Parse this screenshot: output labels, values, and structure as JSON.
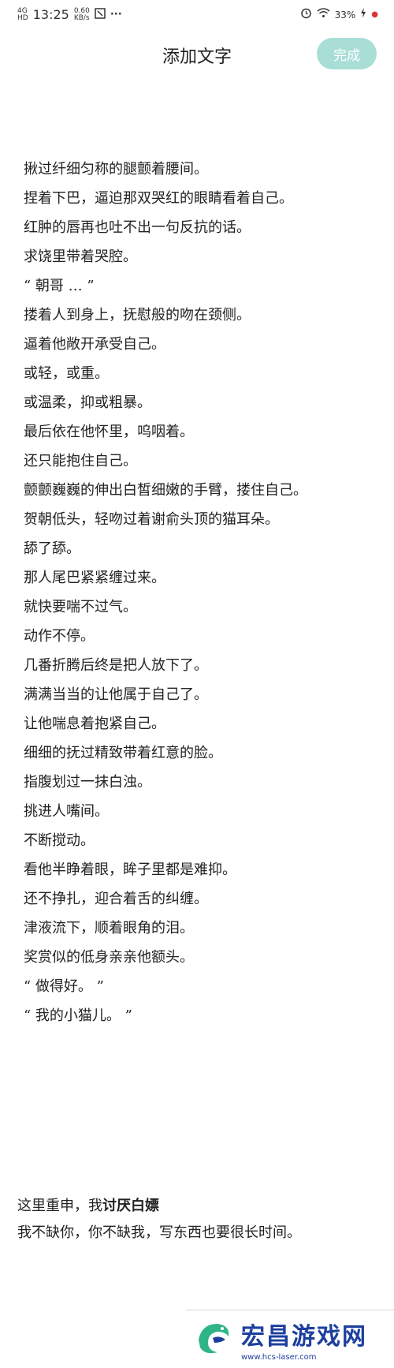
{
  "status_bar": {
    "network": "4G",
    "hd": "HD",
    "time": "13:25",
    "speed": "0.60",
    "speed_unit": "KB/s",
    "more": "···",
    "battery": "33%",
    "icons": [
      "signal-icon",
      "notification-icon",
      "alarm-icon",
      "wifi-icon",
      "charging-icon"
    ]
  },
  "header": {
    "title": "添加文字",
    "done_label": "完成",
    "done_color": "#a8ded6"
  },
  "content": {
    "lines": [
      "揪过纤细匀称的腿颤着腰间。",
      "捏着下巴，逼迫那双哭红的眼睛看着自己。",
      "红肿的唇再也吐不出一句反抗的话。",
      "求饶里带着哭腔。",
      "“ 朝哥 … ”",
      "搂着人到身上，抚慰般的吻在颈侧。",
      "逼着他敞开承受自己。",
      "或轻，或重。",
      "或温柔，抑或粗暴。",
      "最后依在他怀里，呜咽着。",
      "还只能抱住自己。",
      "颤颤巍巍的伸出白皙细嫩的手臂，搂住自己。",
      "贺朝低头，轻吻过着谢俞头顶的猫耳朵。",
      "舔了舔。",
      "那人尾巴紧紧缠过来。",
      "就快要喘不过气。",
      "动作不停。",
      "几番折腾后终是把人放下了。",
      "满满当当的让他属于自己了。",
      "让他喘息着抱紧自己。",
      "细细的抚过精致带着红意的脸。",
      "指腹划过一抹白浊。",
      "挑进人嘴间。",
      "不断搅动。",
      "看他半睁着眼，眸子里都是难抑。",
      "还不挣扎，迎合着舌的纠缠。",
      "津液流下，顺着眼角的泪。",
      "奖赏似的低身亲亲他额头。",
      "“ 做得好。 ”",
      "“ 我的小猫儿。 ”"
    ]
  },
  "note": {
    "line1_prefix": "这里重申，我",
    "line1_bold": "讨厌白嫖",
    "line2": "我不缺你，你不缺我，写东西也要很长时间。"
  },
  "watermark": {
    "title": "宏昌游戏网",
    "url": "www.hcs-laser.com",
    "brand_color": "#1d3f9e"
  }
}
